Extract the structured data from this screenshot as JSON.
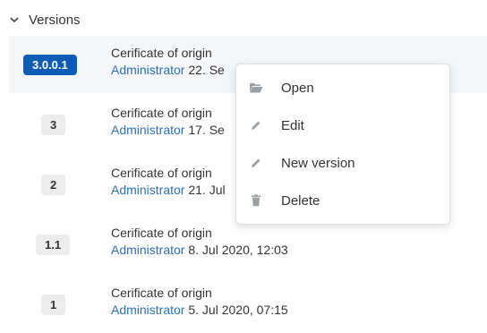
{
  "section": {
    "title": "Versions"
  },
  "versions": [
    {
      "badge": "3.0.0.1",
      "title": "Cerificate of origin",
      "user": "Administrator",
      "date": "22. Se"
    },
    {
      "badge": "3",
      "title": "Cerificate of origin",
      "user": "Administrator",
      "date": "17. Se"
    },
    {
      "badge": "2",
      "title": "Cerificate of origin",
      "user": "Administrator",
      "date": "21. Jul"
    },
    {
      "badge": "1.1",
      "title": "Cerificate of origin",
      "user": "Administrator",
      "date": "8. Jul 2020, 12:03"
    },
    {
      "badge": "1",
      "title": "Cerificate of origin",
      "user": "Administrator",
      "date": "5. Jul 2020, 07:15"
    }
  ],
  "context_menu": {
    "items": [
      {
        "label": "Open",
        "icon": "folder-open-icon"
      },
      {
        "label": "Edit",
        "icon": "pencil-icon"
      },
      {
        "label": "New version",
        "icon": "pencil-icon"
      },
      {
        "label": "Delete",
        "icon": "trash-icon"
      }
    ]
  },
  "colors": {
    "accent": "#0d5db7",
    "link": "#2a6fb5",
    "highlight_row": "#f4f6f8"
  }
}
